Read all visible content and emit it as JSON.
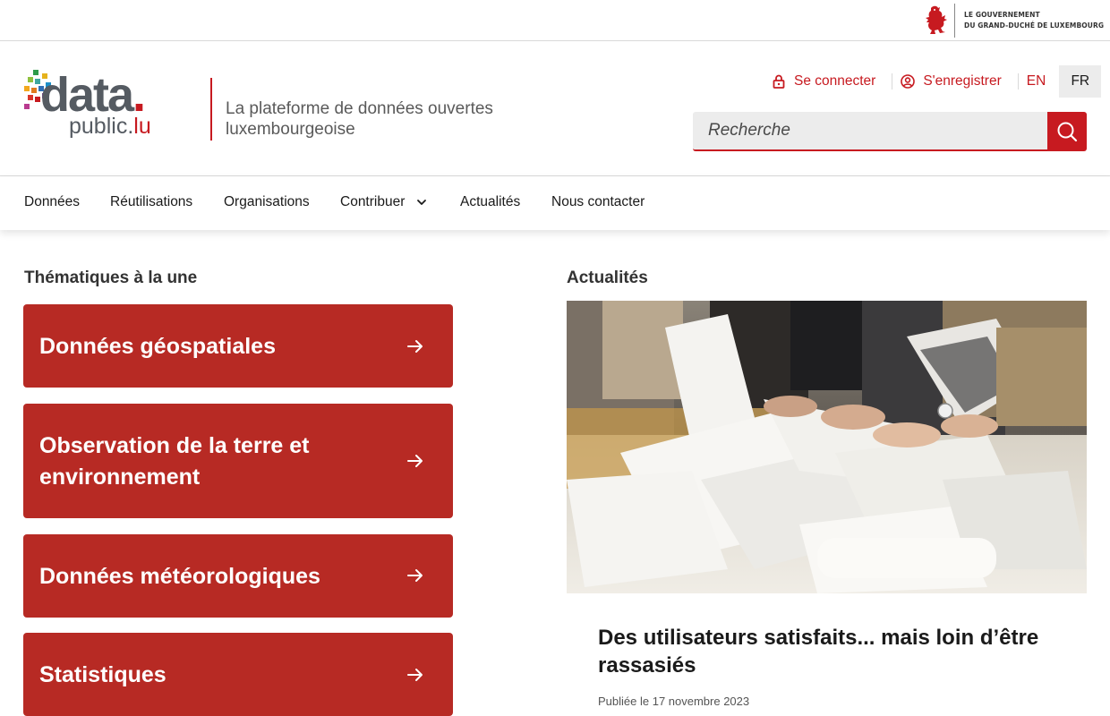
{
  "gov": {
    "line1": "LE GOUVERNEMENT",
    "line2": "DU GRAND-DUCHÉ DE LUXEMBOURG"
  },
  "logo": {
    "data": "data",
    "dot": ".",
    "public": "public.",
    "lu": "lu"
  },
  "tagline": "La plateforme de données ouvertes luxembourgeoise",
  "user_actions": {
    "login": "Se connecter",
    "register": "S'enregistrer",
    "lang_en": "EN",
    "lang_fr": "FR"
  },
  "search": {
    "placeholder": "Recherche"
  },
  "nav": {
    "items": [
      "Données",
      "Réutilisations",
      "Organisations",
      "Contribuer",
      "Actualités",
      "Nous contacter"
    ]
  },
  "themes": {
    "title": "Thématiques à la une",
    "items": [
      "Données géospatiales",
      "Observation de la terre et environnement",
      "Données météorologiques",
      "Statistiques"
    ]
  },
  "news": {
    "title": "Actualités",
    "article_title": "Des utilisateurs satisfaits... mais loin d’être rassasiés",
    "date": "Publiée le 17 novembre 2023"
  },
  "colors": {
    "brand_red": "#c71a20",
    "card_red": "#b72a24"
  },
  "icons": [
    "lion-icon",
    "lock-icon",
    "user-circle-icon",
    "search-icon",
    "chevron-down-icon",
    "arrow-right-icon"
  ]
}
